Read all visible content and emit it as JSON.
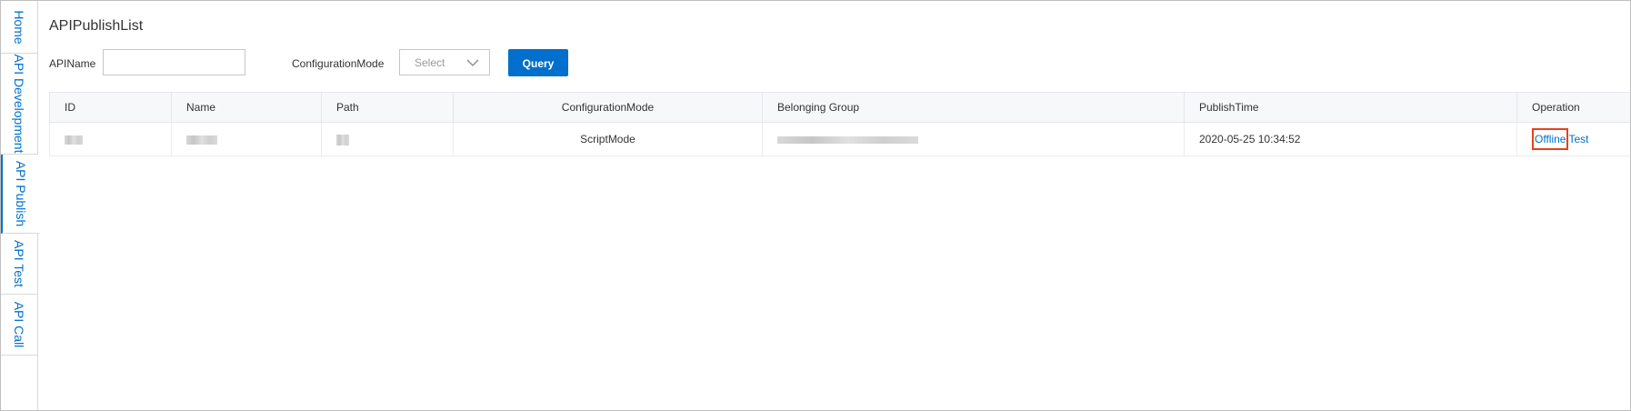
{
  "tabs": [
    {
      "label": "Home",
      "active": false
    },
    {
      "label": "API Development",
      "active": false
    },
    {
      "label": "API Publish",
      "active": true
    },
    {
      "label": "API Test",
      "active": false
    },
    {
      "label": "API Call",
      "active": false
    }
  ],
  "page": {
    "title": "APIPublishList"
  },
  "filters": {
    "api_name_label": "APIName",
    "api_name_value": "",
    "config_mode_label": "ConfigurationMode",
    "config_mode_placeholder": "Select",
    "query_button": "Query"
  },
  "table": {
    "columns": [
      "ID",
      "Name",
      "Path",
      "ConfigurationMode",
      "Belonging Group",
      "PublishTime",
      "Operation"
    ],
    "rows": [
      {
        "id": "",
        "name": "",
        "path": "",
        "configuration_mode": "ScriptMode",
        "belonging_group": "",
        "publish_time": "2020-05-25 10:34:52",
        "operations": [
          "Offline",
          "Test"
        ]
      }
    ]
  },
  "colors": {
    "accent": "#0070cc",
    "highlight": "#e8401c"
  }
}
